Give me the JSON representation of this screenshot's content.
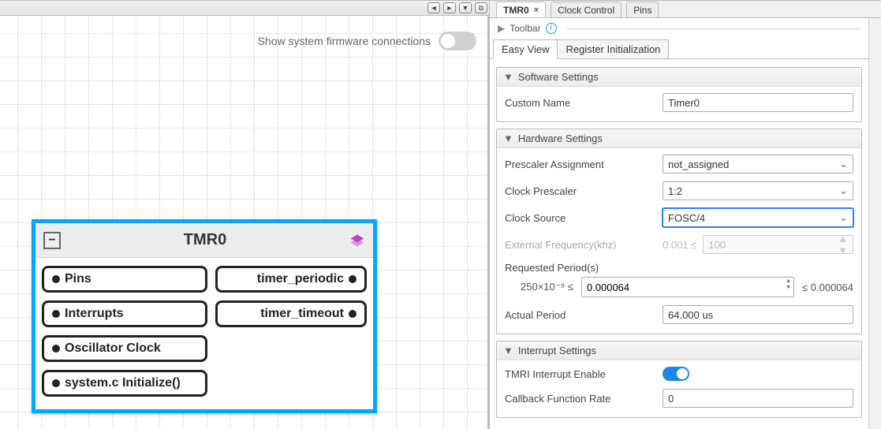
{
  "left": {
    "toggle_label": "Show system firmware connections",
    "toggle_on": false,
    "nav_buttons": [
      "◄",
      "►",
      "▼",
      "⧉"
    ],
    "node": {
      "title": "TMR0",
      "ports_left": [
        "Pins",
        "Interrupts",
        "Oscillator Clock",
        "system.c Initialize()"
      ],
      "ports_right": [
        "timer_periodic",
        "timer_timeout"
      ]
    }
  },
  "tabs": [
    {
      "label": "TMR0",
      "active": true,
      "closable": true
    },
    {
      "label": "Clock Control",
      "active": false,
      "closable": false
    },
    {
      "label": "Pins",
      "active": false,
      "closable": false
    }
  ],
  "toolbar_label": "Toolbar",
  "view_tabs": [
    {
      "label": "Easy View",
      "active": true
    },
    {
      "label": "Register Initialization",
      "active": false
    }
  ],
  "sections": {
    "software": {
      "title": "Software Settings",
      "custom_name_label": "Custom Name",
      "custom_name_value": "Timer0"
    },
    "hardware": {
      "title": "Hardware Settings",
      "prescaler_assignment_label": "Prescaler Assignment",
      "prescaler_assignment_value": "not_assigned",
      "clock_prescaler_label": "Clock Prescaler",
      "clock_prescaler_value": "1:2",
      "clock_source_label": "Clock Source",
      "clock_source_value": "FOSC/4",
      "ext_freq_label": "External Frequency(khz)",
      "ext_freq_min": "0.001 ≤",
      "ext_freq_placeholder": "100",
      "req_period_label": "Requested Period(s)",
      "req_period_min": "250×10⁻⁹ ≤",
      "req_period_value": "0.000064",
      "req_period_max": "≤ 0.000064",
      "actual_period_label": "Actual Period",
      "actual_period_value": "64.000 us"
    },
    "interrupt": {
      "title": "Interrupt Settings",
      "enable_label": "TMRI Interrupt Enable",
      "enable_on": true,
      "callback_label": "Callback Function Rate",
      "callback_value": "0"
    }
  }
}
